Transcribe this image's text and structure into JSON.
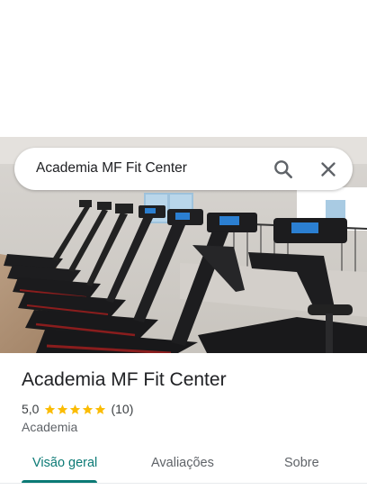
{
  "search": {
    "query": "Academia MF Fit Center"
  },
  "place": {
    "name": "Academia MF Fit Center",
    "rating": "5,0",
    "stars": 5,
    "review_count": "(10)",
    "category": "Academia"
  },
  "tabs": [
    {
      "label": "Visão geral",
      "active": true
    },
    {
      "label": "Avaliações",
      "active": false
    },
    {
      "label": "Sobre",
      "active": false
    }
  ],
  "colors": {
    "accent": "#0b7a75",
    "star": "#fbbc04",
    "text_primary": "#202124",
    "text_secondary": "#5f6368"
  },
  "icons": {
    "search": "search-icon",
    "close": "close-icon",
    "star": "star-icon"
  }
}
